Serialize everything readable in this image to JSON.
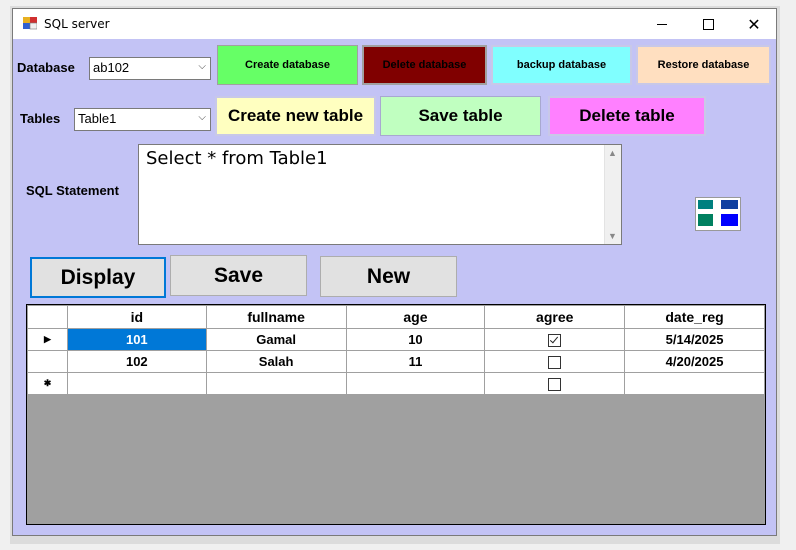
{
  "window": {
    "title": "SQL server"
  },
  "database": {
    "label": "Database",
    "value": "ab102"
  },
  "db_buttons": {
    "create": "Create database",
    "delete": "Delete database",
    "backup": "backup database",
    "restore": "Restore database"
  },
  "tables": {
    "label": "Tables",
    "value": "Table1"
  },
  "table_buttons": {
    "create": "Create new table",
    "save": "Save table",
    "delete": "Delete table"
  },
  "sql": {
    "label": "SQL Statement",
    "value": "Select * from Table1"
  },
  "actions": {
    "display": "Display",
    "save": "Save",
    "new": "New"
  },
  "grid": {
    "columns": [
      "id",
      "fullname",
      "age",
      "agree",
      "date_reg"
    ],
    "rows": [
      {
        "id": "101",
        "fullname": "Gamal",
        "age": "10",
        "agree": true,
        "date_reg": "5/14/2025"
      },
      {
        "id": "102",
        "fullname": "Salah",
        "age": "11",
        "agree": false,
        "date_reg": "4/20/2025"
      }
    ]
  },
  "colors": {
    "form_bg": "#c3c3f5",
    "create_db": "#66ff66",
    "delete_db": "#800000",
    "backup_db": "#80ffff",
    "restore_db": "#ffdfc0",
    "create_table": "#ffffc0",
    "save_table": "#c0ffc0",
    "delete_table": "#ff80ff",
    "selection": "#0078d7"
  },
  "icons": {
    "app": "app-icon",
    "layout": "layout-icon"
  }
}
